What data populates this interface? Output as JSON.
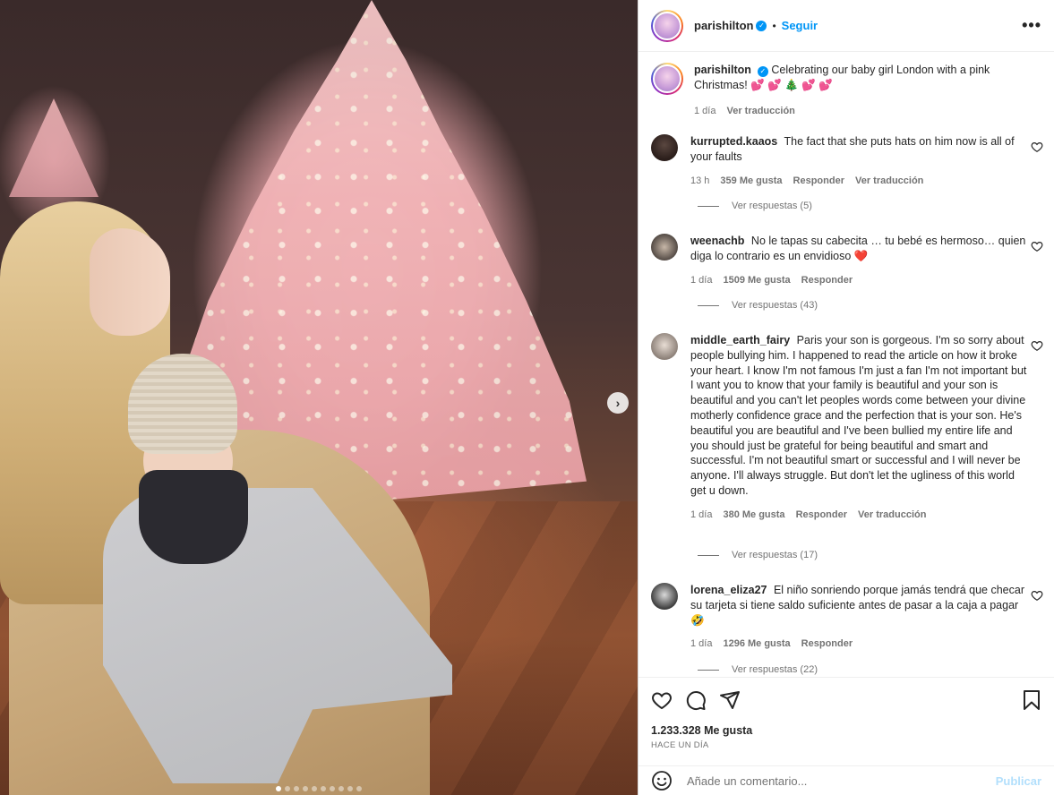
{
  "post": {
    "username": "parishilton",
    "follow_label": "Seguir",
    "separator": "•",
    "more_label": "•••",
    "caption": "Celebrating our baby girl London with a pink Christmas! 💕 💕 🎄 💕 💕",
    "caption_time": "1 día",
    "caption_translate": "Ver traducción",
    "next_arrow": "›",
    "slides": 10,
    "active_slide": 1
  },
  "comments": [
    {
      "username": "kurrupted.kaaos",
      "text": "The fact that she puts hats on him now is all of your faults",
      "time": "13 h",
      "likes": "359 Me gusta",
      "reply": "Responder",
      "translate": "Ver traducción",
      "replies": "Ver respuestas (5)"
    },
    {
      "username": "weenachb",
      "text": "No le tapas su cabecita … tu bebé es hermoso… quien diga lo contrario es un envidioso ❤️",
      "time": "1 día",
      "likes": "1509 Me gusta",
      "reply": "Responder",
      "replies": "Ver respuestas (43)"
    },
    {
      "username": "middle_earth_fairy",
      "text": "Paris your son is gorgeous. I'm so sorry about people bullying him. I happened to read the article on how it broke your heart. I know I'm not famous I'm just a fan I'm not important but I want you to know that your family is beautiful and your son is beautiful and you can't let peoples words come between your divine motherly confidence grace and the perfection that is your son. He's beautiful you are beautiful and I've been bullied my entire life and you should just be grateful for being beautiful and smart and successful. I'm not beautiful smart or successful and I will never be anyone. I'll always struggle. But don't let the ugliness of this world get u down.",
      "time": "1 día",
      "likes": "380 Me gusta",
      "reply": "Responder",
      "translate": "Ver traducción",
      "replies": "Ver respuestas (17)"
    },
    {
      "username": "lorena_eliza27",
      "text": "El niño sonriendo porque jamás tendrá que checar su tarjeta si tiene saldo suficiente antes de pasar a la caja a pagar 🤣",
      "time": "1 día",
      "likes": "1296 Me gusta",
      "reply": "Responder",
      "replies": "Ver respuestas (22)"
    }
  ],
  "footer": {
    "likes": "1.233.328 Me gusta",
    "when": "HACE UN DÍA",
    "comment_placeholder": "Añade un comentario...",
    "publish": "Publicar"
  },
  "colors": {
    "link_blue": "#0095f6",
    "muted": "#737373",
    "text": "#262626"
  }
}
